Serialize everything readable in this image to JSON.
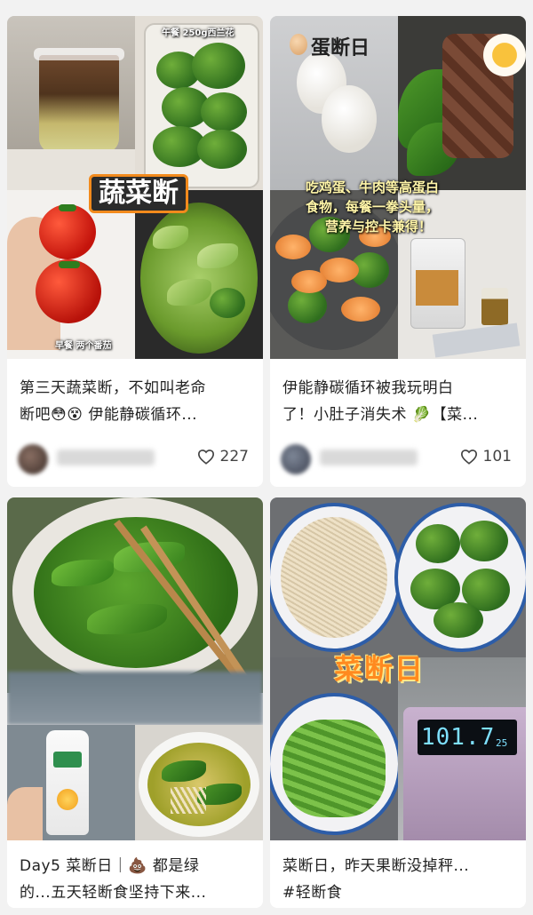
{
  "feed": {
    "cards": [
      {
        "title": "第三天蔬菜断，不如叫老命\n断吧😳😵 伊能静碳循环...",
        "likes": "227",
        "cover_text": {
          "sticker": "蔬菜断",
          "top_note": "午餐 250g西兰花",
          "bottom_note": "早餐 两个番茄"
        }
      },
      {
        "title": "伊能静碳循环被我玩明白\n了！小肚子消失术 🥬【菜...",
        "likes": "101",
        "cover_text": {
          "heading": "蛋断日",
          "caption_line1": "吃鸡蛋、牛肉等高蛋白",
          "caption_line2": "食物，每餐一拳头量，",
          "caption_line3": "营养与控卡兼得！"
        }
      },
      {
        "title": "Day5 菜断日｜💩 都是绿\n的...五天轻断食坚持下来..."
      },
      {
        "title": "菜断日，昨天果断没掉秤...\n#轻断食",
        "cover_text": {
          "heading": "菜断日",
          "scale_reading": "101.7",
          "scale_small": "25"
        }
      }
    ]
  },
  "colors": {
    "background": "#f2f2f2",
    "card": "#ffffff",
    "title_text": "#222222",
    "likes_text": "#444444",
    "sticker_orange": "#f28a1c",
    "scale_display": "#7ee0ff"
  },
  "icons": {
    "like": "heart-outline-icon"
  }
}
